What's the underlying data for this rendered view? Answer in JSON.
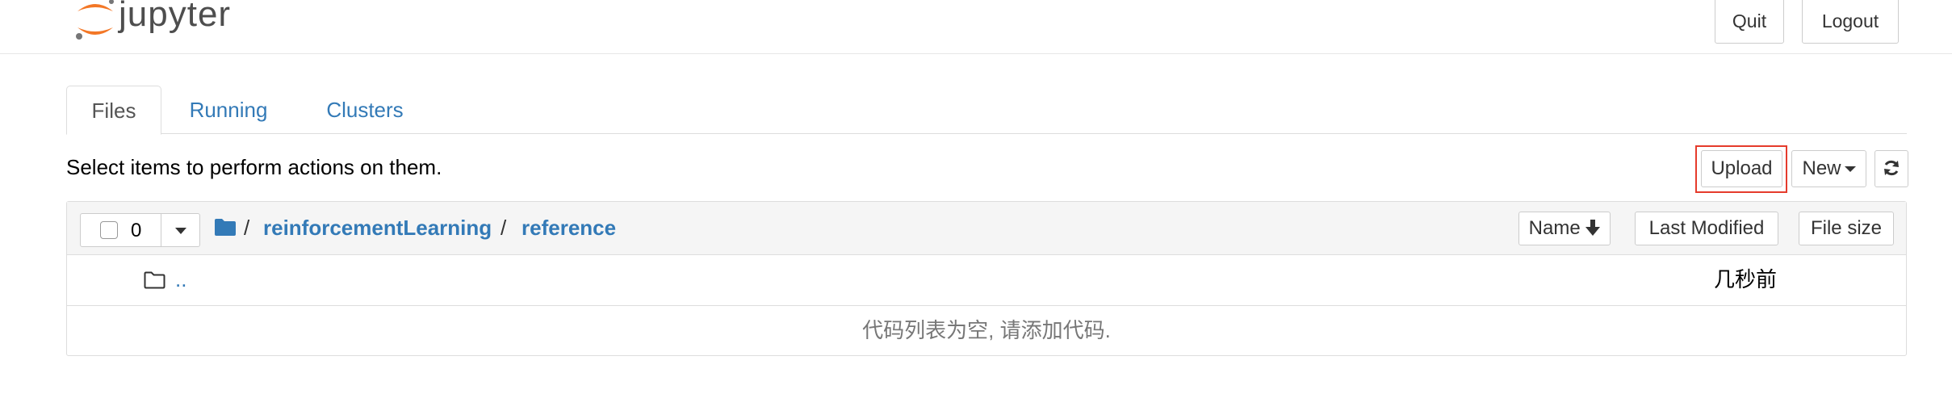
{
  "header": {
    "logo_text": "jupyter",
    "quit_label": "Quit",
    "logout_label": "Logout"
  },
  "tabs": [
    {
      "label": "Files",
      "active": true
    },
    {
      "label": "Running",
      "active": false
    },
    {
      "label": "Clusters",
      "active": false
    }
  ],
  "toolbar": {
    "hint": "Select items to perform actions on them.",
    "upload_label": "Upload",
    "new_label": "New",
    "refresh_icon": "refresh-icon"
  },
  "list": {
    "selected_count": "0",
    "breadcrumb": {
      "root_separator": "/",
      "items": [
        "reinforcementLearning",
        "reference"
      ],
      "separator": "/"
    },
    "sort": {
      "name_label": "Name",
      "modified_label": "Last Modified",
      "size_label": "File size"
    },
    "rows": [
      {
        "name": "..",
        "modified": "几秒前",
        "icon": "folder-outline-icon"
      }
    ],
    "empty_message": "代码列表为空, 请添加代码."
  },
  "colors": {
    "link": "#337ab7",
    "highlight": "#e53b2c",
    "logo_orange": "#f37726"
  }
}
